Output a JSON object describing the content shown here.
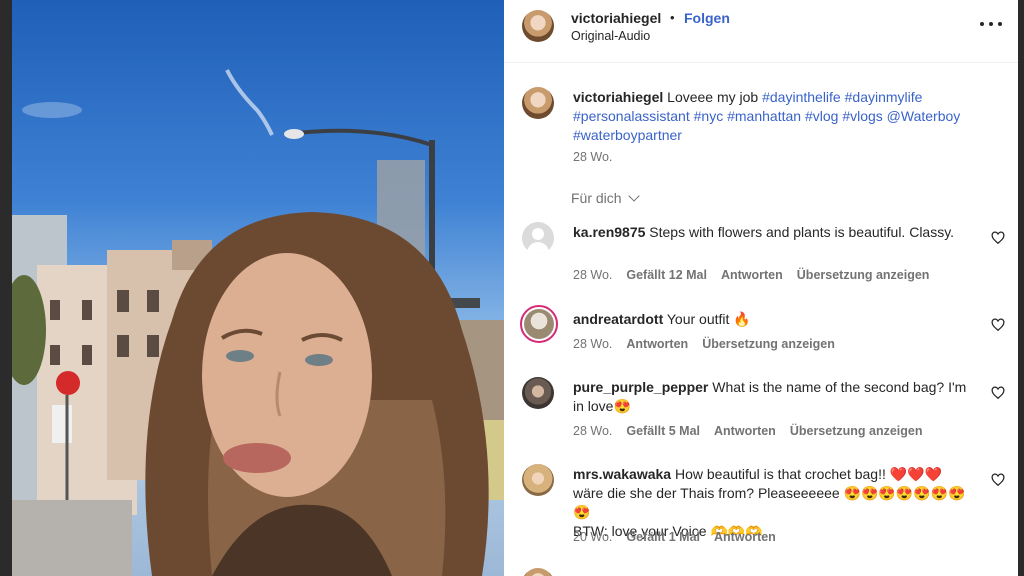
{
  "header": {
    "username": "victoriahiegel",
    "separator": "•",
    "follow_label": "Folgen",
    "audio": "Original-Audio",
    "more_icon": "more-icon"
  },
  "caption": {
    "username": "victoriahiegel",
    "text": "Loveee my job",
    "hashtags": [
      "#dayinthelife",
      "#dayinmylife",
      "#personalassistant",
      "#nyc",
      "#manhattan",
      "#vlog",
      "#vlogs",
      "@Waterboy",
      "#waterboypartner"
    ],
    "time": "28 Wo."
  },
  "filter_label": "Für dich",
  "comments": [
    {
      "username": "ka.ren9875",
      "text": "Steps with flowers and plants is beautiful. Classy.",
      "time": "28 Wo.",
      "likes": "Gefällt 12 Mal",
      "reply": "Antworten",
      "translate": "Übersetzung anzeigen"
    },
    {
      "username": "andreatardott",
      "text": "Your outfit 🔥",
      "time": "28 Wo.",
      "reply": "Antworten",
      "translate": "Übersetzung anzeigen"
    },
    {
      "username": "pure_purple_pepper",
      "text": "What is the name of the second bag? I'm in love😍",
      "time": "28 Wo.",
      "likes": "Gefällt 5 Mal",
      "reply": "Antworten",
      "translate": "Übersetzung anzeigen"
    },
    {
      "username": "mrs.wakawaka",
      "line1": "How beautiful is that crochet bag!! ❤️❤️❤️",
      "line2": "wäre die she der Thais from? Pleaseeeeee 😍😍😍😍😍😍😍😍",
      "line3": "BTW: love your Voice 🫶🫶🫶",
      "time": "20 Wo.",
      "likes": "Gefällt 1 Mal",
      "reply": "Antworten"
    }
  ],
  "colors": {
    "link": "#3a63c9",
    "muted": "#737373",
    "text": "#262626",
    "story_ring": "#d62976"
  }
}
